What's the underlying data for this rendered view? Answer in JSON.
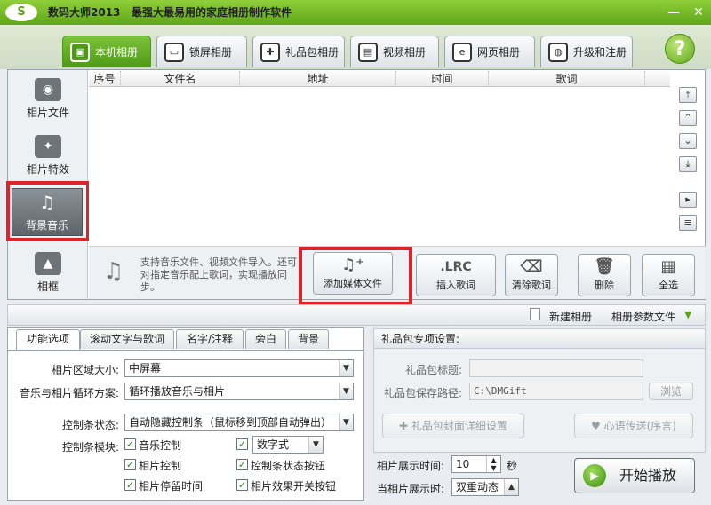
{
  "window": {
    "logo_text": "S",
    "title": "数码大师2013",
    "subtitle": "最强大最易用的家庭相册制作软件",
    "minimize_glyph": "—",
    "close_glyph": "✕"
  },
  "tabs": [
    {
      "label": "本机相册",
      "icon": "photo-album-icon",
      "glyph": "▣",
      "active": true
    },
    {
      "label": "锁屏相册",
      "icon": "monitor-icon",
      "glyph": "▭",
      "active": false
    },
    {
      "label": "礼品包相册",
      "icon": "gift-icon",
      "glyph": "✚",
      "active": false
    },
    {
      "label": "视频相册",
      "icon": "film-icon",
      "glyph": "▤",
      "active": false
    },
    {
      "label": "网页相册",
      "icon": "ie-icon",
      "glyph": "e",
      "active": false
    },
    {
      "label": "升级和注册",
      "icon": "globe-icon",
      "glyph": "◍",
      "active": false
    }
  ],
  "help_glyph": "?",
  "sidebar": [
    {
      "label": "相片文件",
      "icon": "camera-icon",
      "glyph": "◉"
    },
    {
      "label": "相片特效",
      "icon": "effects-icon",
      "glyph": "✦"
    },
    {
      "label": "背景音乐",
      "icon": "music-note-icon",
      "glyph": "♫",
      "active": true
    },
    {
      "label": "相框",
      "icon": "frame-icon",
      "glyph": "▲"
    }
  ],
  "table": {
    "columns": [
      "序号",
      "文件名",
      "地址",
      "时间",
      "歌词"
    ],
    "rows": []
  },
  "nav_buttons": [
    {
      "name": "move-top-button",
      "glyph": "⤒"
    },
    {
      "name": "move-up-button",
      "glyph": "⌃"
    },
    {
      "name": "move-down-button",
      "glyph": "⌄"
    },
    {
      "name": "move-bottom-button",
      "glyph": "⤓"
    },
    {
      "name": "play-preview-button",
      "glyph": "▸"
    },
    {
      "name": "properties-button",
      "glyph": "≡"
    }
  ],
  "hint": {
    "icon_glyph": "♫",
    "text": "支持音乐文件、视频文件导入。还可对指定音乐配上歌词，实现播放同步。"
  },
  "actions": [
    {
      "label": "添加媒体文件",
      "glyph": "♫⁺"
    },
    {
      "label": "插入歌词",
      "glyph": ".LRC"
    },
    {
      "label": "清除歌词",
      "glyph": "⌫"
    },
    {
      "label": "删除",
      "glyph": "🗑"
    },
    {
      "label": "全选",
      "glyph": "▦"
    }
  ],
  "strip": {
    "new_album_label": "新建相册",
    "album_params_label": "相册参数文件",
    "arrow_glyph": "▼"
  },
  "lower_tabs": [
    "功能选项",
    "滚动文字与歌词",
    "名字/注释",
    "旁白",
    "背景"
  ],
  "options": {
    "area_size_label": "相片区域大小:",
    "area_size_value": "中屏幕",
    "loop_label": "音乐与相片循环方案:",
    "loop_value": "循环播放音乐与相片",
    "controlbar_state_label": "控制条状态:",
    "controlbar_state_value": "自动隐藏控制条（鼠标移到顶部自动弹出）",
    "controlbar_modules_label": "控制条模块:",
    "combo_arrow": "▼",
    "checkboxes": [
      {
        "label": "音乐控制",
        "checked": true
      },
      {
        "label": "相片控制",
        "checked": true
      },
      {
        "label": "相片停留时间",
        "checked": true
      },
      {
        "label": "数字式",
        "checked": true,
        "is_combo": true
      },
      {
        "label": "控制条状态按钮",
        "checked": true
      },
      {
        "label": "相片效果开关按钮",
        "checked": true
      }
    ],
    "check_glyph": "✓"
  },
  "giftpack": {
    "header": "礼品包专项设置:",
    "title_label": "礼品包标题:",
    "title_value": "",
    "path_label": "礼品包保存路径:",
    "path_value": "C:\\DMGift",
    "browse_label": "浏览",
    "cover_label": "礼品包封面详细设置",
    "greeting_label": "心语传送(序言)"
  },
  "playback": {
    "display_time_label": "相片展示时间:",
    "display_time_value": "10",
    "unit": "秒",
    "when_display_label": "当相片展示时:",
    "when_display_value": "双重动态",
    "spin_up": "▲",
    "spin_down": "▼",
    "start_label": "开始播放",
    "start_glyph": "▶"
  }
}
